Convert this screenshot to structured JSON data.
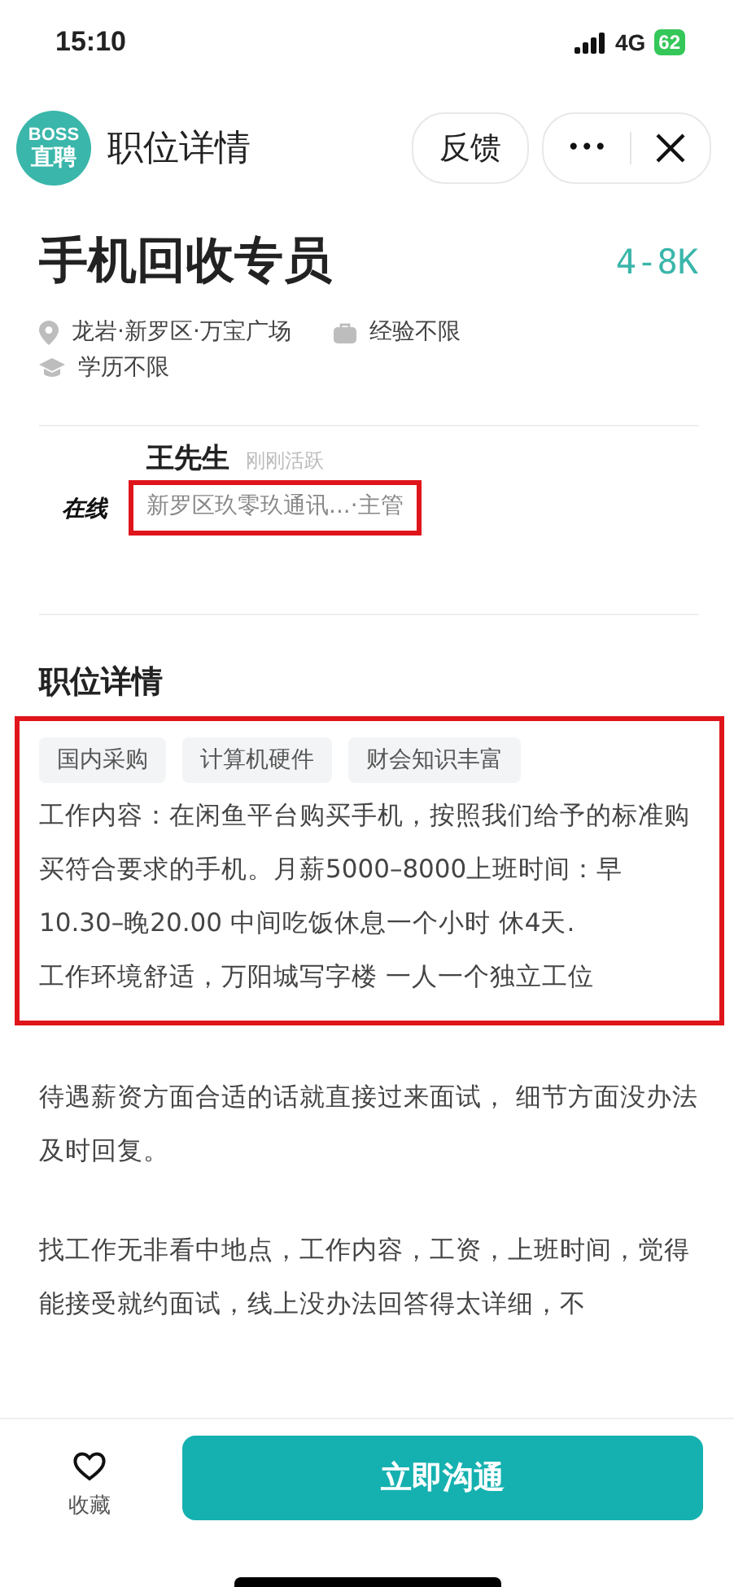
{
  "status_bar": {
    "time": "15:10",
    "network": "4G",
    "battery": "62"
  },
  "header": {
    "logo_top": "BOSS",
    "logo_bottom": "直聘",
    "title": "职位详情",
    "feedback": "反馈",
    "more": "•••"
  },
  "job": {
    "title": "手机回收专员",
    "salary": "4-8K",
    "meta": [
      {
        "kind": "location",
        "text": "龙岩·新罗区·万宝广场"
      },
      {
        "kind": "experience",
        "text": "经验不限"
      },
      {
        "kind": "education",
        "text": "学历不限"
      }
    ]
  },
  "recruiter": {
    "avatar_text": "在线",
    "name": "王先生",
    "activity": "刚刚活跃",
    "company": "新罗区玖零玖通讯...·主管",
    "highlighted": true
  },
  "details": {
    "heading": "职位详情",
    "highlighted": true,
    "tags": [
      "国内采购",
      "计算机硬件",
      "财会知识丰富"
    ],
    "description": [
      "工作内容：在闲鱼平台购买手机，按照我们给予的标准购买符合要求的手机。月薪5000–8000上班时间：早10.30–晚20.00 中间吃饭休息一个小时 休4天.",
      "工作环境舒适，万阳城写字楼 一人一个独立工位"
    ],
    "paragraphs": [
      "待遇薪资方面合适的话就直接过来面试， 细节方面没办法及时回复。",
      "找工作无非看中地点，工作内容，工资，上班时间，觉得能接受就约面试，线上没办法回答得太详细，不"
    ]
  },
  "bottom_bar": {
    "favorite": "收藏",
    "chat": "立即沟通"
  }
}
